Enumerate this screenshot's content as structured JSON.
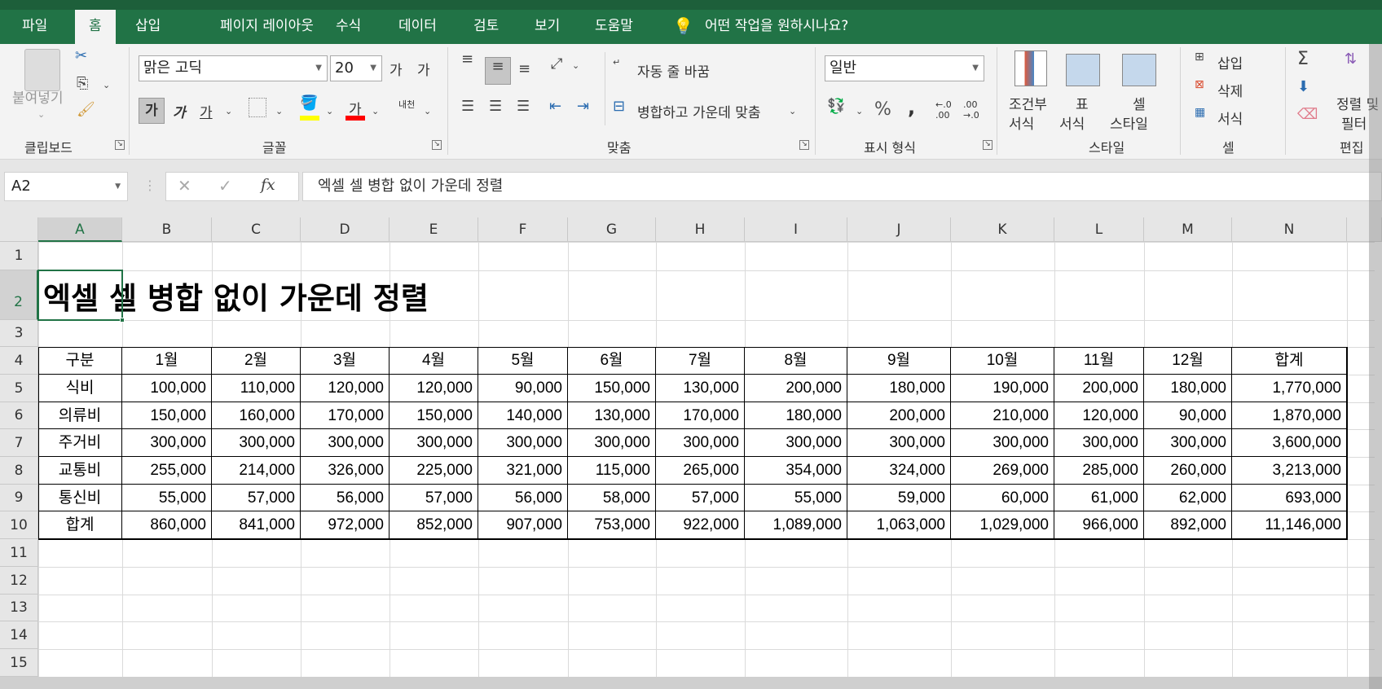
{
  "tabs": [
    "파일",
    "홈",
    "삽입",
    "페이지 레이아웃",
    "수식",
    "데이터",
    "검토",
    "보기",
    "도움말"
  ],
  "active_tab": "홈",
  "tell_me": "어떤 작업을 원하시나요?",
  "clipboard": {
    "paste": "붙여넣기",
    "label": "클립보드"
  },
  "font": {
    "name": "맑은 고딕",
    "size": "20",
    "grow": "가",
    "shrink": "가",
    "bold": "가",
    "italic": "가",
    "underline": "가",
    "phonetic": "내천",
    "label": "글꼴"
  },
  "align": {
    "wrap": "자동 줄 바꿈",
    "merge": "병합하고 가운데 맞춤",
    "label": "맞춤"
  },
  "number": {
    "format": "일반",
    "percent": "%",
    "comma": ",",
    "inc": "←.0 .00",
    "dec": ".00 →.0",
    "label": "표시 형식"
  },
  "styles": {
    "cond1": "조건부",
    "cond2": "서식",
    "table1": "표",
    "table2": "서식",
    "cell1": "셀",
    "cell2": "스타일",
    "label": "스타일"
  },
  "cells": {
    "insert": "삽입",
    "delete": "삭제",
    "format": "서식",
    "label": "셀"
  },
  "editing": {
    "sort1": "정렬 및",
    "sort2": "필터",
    "label": "편집"
  },
  "namebox": "A2",
  "formula": "엑셀 셀 병합 없이 가운데 정렬",
  "columns": [
    "A",
    "B",
    "C",
    "D",
    "E",
    "F",
    "G",
    "H",
    "I",
    "J",
    "K",
    "L",
    "M",
    "N"
  ],
  "rows": [
    "1",
    "2",
    "3",
    "4",
    "5",
    "6",
    "7",
    "8",
    "9",
    "10",
    "11",
    "12",
    "13",
    "14",
    "15"
  ],
  "title": "엑셀 셀 병합 없이 가운데 정렬",
  "table": {
    "header": [
      "구분",
      "1월",
      "2월",
      "3월",
      "4월",
      "5월",
      "6월",
      "7월",
      "8월",
      "9월",
      "10월",
      "11월",
      "12월",
      "합계"
    ],
    "body": [
      [
        "식비",
        "100,000",
        "110,000",
        "120,000",
        "120,000",
        "90,000",
        "150,000",
        "130,000",
        "200,000",
        "180,000",
        "190,000",
        "200,000",
        "180,000",
        "1,770,000"
      ],
      [
        "의류비",
        "150,000",
        "160,000",
        "170,000",
        "150,000",
        "140,000",
        "130,000",
        "170,000",
        "180,000",
        "200,000",
        "210,000",
        "120,000",
        "90,000",
        "1,870,000"
      ],
      [
        "주거비",
        "300,000",
        "300,000",
        "300,000",
        "300,000",
        "300,000",
        "300,000",
        "300,000",
        "300,000",
        "300,000",
        "300,000",
        "300,000",
        "300,000",
        "3,600,000"
      ],
      [
        "교통비",
        "255,000",
        "214,000",
        "326,000",
        "225,000",
        "321,000",
        "115,000",
        "265,000",
        "354,000",
        "324,000",
        "269,000",
        "285,000",
        "260,000",
        "3,213,000"
      ],
      [
        "통신비",
        "55,000",
        "57,000",
        "56,000",
        "57,000",
        "56,000",
        "58,000",
        "57,000",
        "55,000",
        "59,000",
        "60,000",
        "61,000",
        "62,000",
        "693,000"
      ],
      [
        "합계",
        "860,000",
        "841,000",
        "972,000",
        "852,000",
        "907,000",
        "753,000",
        "922,000",
        "1,089,000",
        "1,063,000",
        "1,029,000",
        "966,000",
        "892,000",
        "11,146,000"
      ]
    ]
  },
  "colors": {
    "accent": "#217346",
    "highlight": "#ffff00",
    "font_color": "#ff0000"
  }
}
